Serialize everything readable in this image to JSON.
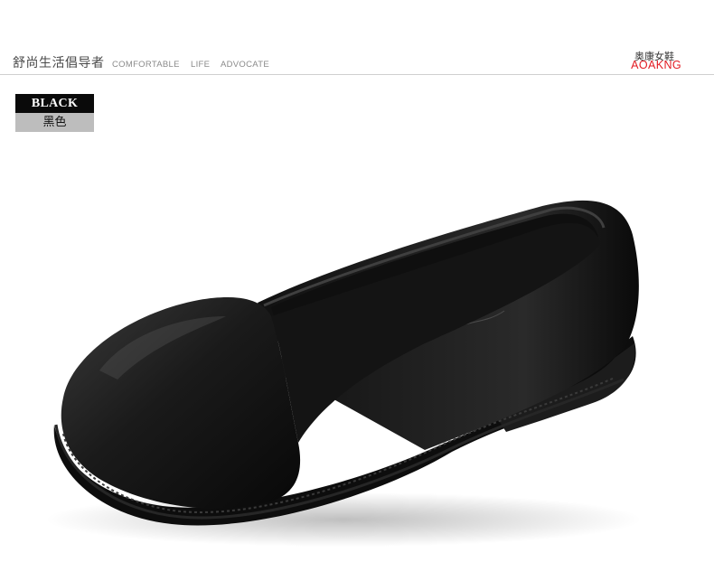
{
  "header": {
    "slogan_cn": "舒尚生活倡导者",
    "slogan_en": [
      "COMFORTABLE",
      "LIFE",
      "ADVOCATE"
    ],
    "brand_cn": "奥康女鞋",
    "brand_en": "AOAKNG"
  },
  "color_tag": {
    "en": "BLACK",
    "cn": "黑色"
  },
  "product": {
    "icon": "black-leather-loafer-image"
  },
  "colors": {
    "brand_red": "#e21a22",
    "tag_black": "#0a0a0a",
    "tag_grey": "#bdbdbd",
    "rule": "#cfcfcf"
  }
}
